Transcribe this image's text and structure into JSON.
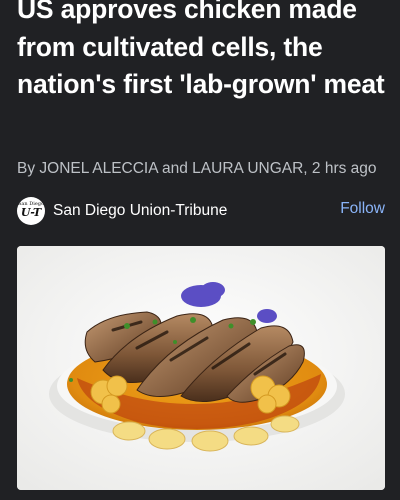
{
  "article": {
    "headline": "US approves chicken made from cultivated cells, the nation's first 'lab-grown' meat",
    "byline": "By JONEL ALECCIA and LAURA UNGAR, 2 hrs ago",
    "image_alt": "Plated cultivated chicken with sauce and vegetables"
  },
  "source": {
    "name": "San Diego Union-Tribune",
    "logo_top": "San Diego",
    "logo_mark": "U-T",
    "follow_label": "Follow"
  },
  "colors": {
    "background": "#202124",
    "headline": "#ffffff",
    "byline": "#bdc1c6",
    "link": "#8ab4f8"
  }
}
